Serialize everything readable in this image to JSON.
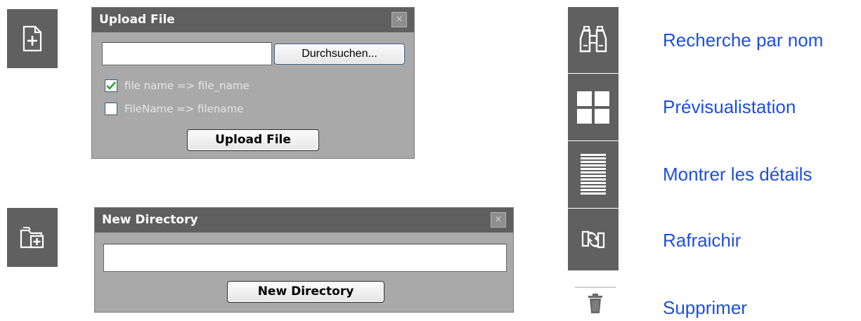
{
  "upload_dialog": {
    "title": "Upload File",
    "close_glyph": "×",
    "browse_label": "Durchsuchen...",
    "options": [
      {
        "label": "file name => file_name",
        "checked": true
      },
      {
        "label": "FileName => filename",
        "checked": false
      }
    ],
    "submit_label": "Upload File"
  },
  "directory_dialog": {
    "title": "New Directory",
    "close_glyph": "×",
    "submit_label": "New Directory"
  },
  "actions": [
    {
      "label": "Recherche par nom",
      "icon": "binoculars-icon"
    },
    {
      "label": "Prévisualistation",
      "icon": "grid-view-icon"
    },
    {
      "label": "Montrer les détails",
      "icon": "list-details-icon"
    },
    {
      "label": "Rafraichir",
      "icon": "refresh-icon"
    },
    {
      "label": "Supprimer",
      "icon": "trash-icon"
    }
  ],
  "colors": {
    "icon_bg": "#606060",
    "dialog_body": "#a9a9a9",
    "dialog_title": "#5f5f5f",
    "link": "#1e4fd9",
    "check": "#2aa13a"
  }
}
